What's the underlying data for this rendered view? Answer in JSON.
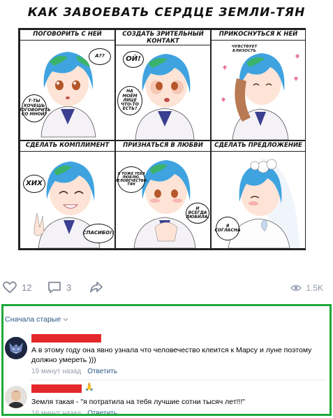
{
  "comic": {
    "title": "КАК ЗАВОЕВАТЬ СЕРДЦЕ ЗЕМЛИ-ТЯН",
    "panels": [
      {
        "label": "ПОГОВОРИТЬ С НЕЙ",
        "bubbles": [
          "А??",
          "Т-ТЫ ХОЧЕШЬ ПОГОВОРИТЬ СО МНОЙ?"
        ]
      },
      {
        "label": "СОЗДАТЬ ЗРИТЕЛЬНЫЙ КОНТАКТ",
        "bubbles": [
          "ОЙ!",
          "НА МОЁМ ЛИЦЕ ЧТО-ТО ЕСТЬ?"
        ]
      },
      {
        "label": "ПРИКОСНУТЬСЯ К НЕЙ",
        "bubbles": [
          "ЧУВСТВУЕТ БЛИЗОСТЬ"
        ]
      },
      {
        "label": "СДЕЛАТЬ КОМПЛИМЕНТ",
        "bubbles": [
          "ХИХ",
          "СПАСИБО!!"
        ]
      },
      {
        "label": "ПРИЗНАТЬСЯ В ЛЮБВИ",
        "bubbles": [
          "Я ТОЖЕ ТЕБЯ ЛЮБЛЮ, ЧЕЛОВЕЧЕСТВО-ТЯН",
          "И ВСЕГДА ЛЮБИЛА."
        ]
      },
      {
        "label": "СДЕЛАТЬ ПРЕДЛОЖЕНИЕ",
        "bubbles": [
          "Я СОГЛАСНА"
        ]
      }
    ]
  },
  "actions": {
    "likes": "12",
    "comments": "3",
    "views": "1.5K",
    "icons": {
      "like": "heart-icon",
      "comment": "comment-bubble-icon",
      "share": "share-arrow-icon",
      "views": "eye-icon"
    }
  },
  "comments_section": {
    "sort_label": "Сначала старые",
    "items": [
      {
        "text": "А в этому году она явно узнала что человечество клеится к Марсу и луне поэтому должно умереть )))",
        "time": "19 минут назад",
        "reply": "Ответить"
      },
      {
        "text": "Земля такая - \"я потратила на тебя лучшие сотни тысяч лет!!!\"",
        "time": "16 минут назад",
        "reply": "Ответить"
      }
    ]
  },
  "colors": {
    "accent": "#2a5885",
    "frame": "#1fa83a",
    "redact": "#e3282b",
    "muted": "#828a99"
  }
}
